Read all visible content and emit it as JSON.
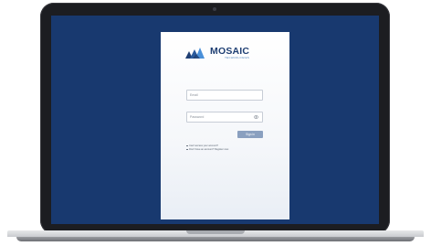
{
  "brand": {
    "name": "MOSAIC",
    "tagline": "TECHNOLOGIES"
  },
  "login": {
    "email_placeholder": "Email",
    "password_placeholder": "Password",
    "signin_label": "Sign in",
    "forgot_link": "Can't access your account?",
    "register_link": "Don't have an account? Register now."
  },
  "colors": {
    "screen_background": "#18396f",
    "brand_primary": "#1f3f73",
    "brand_secondary": "#4a90d9",
    "button": "#8aa0bf"
  },
  "icons": [
    "mosaic-logo-icon",
    "eye-icon",
    "camera-icon"
  ]
}
